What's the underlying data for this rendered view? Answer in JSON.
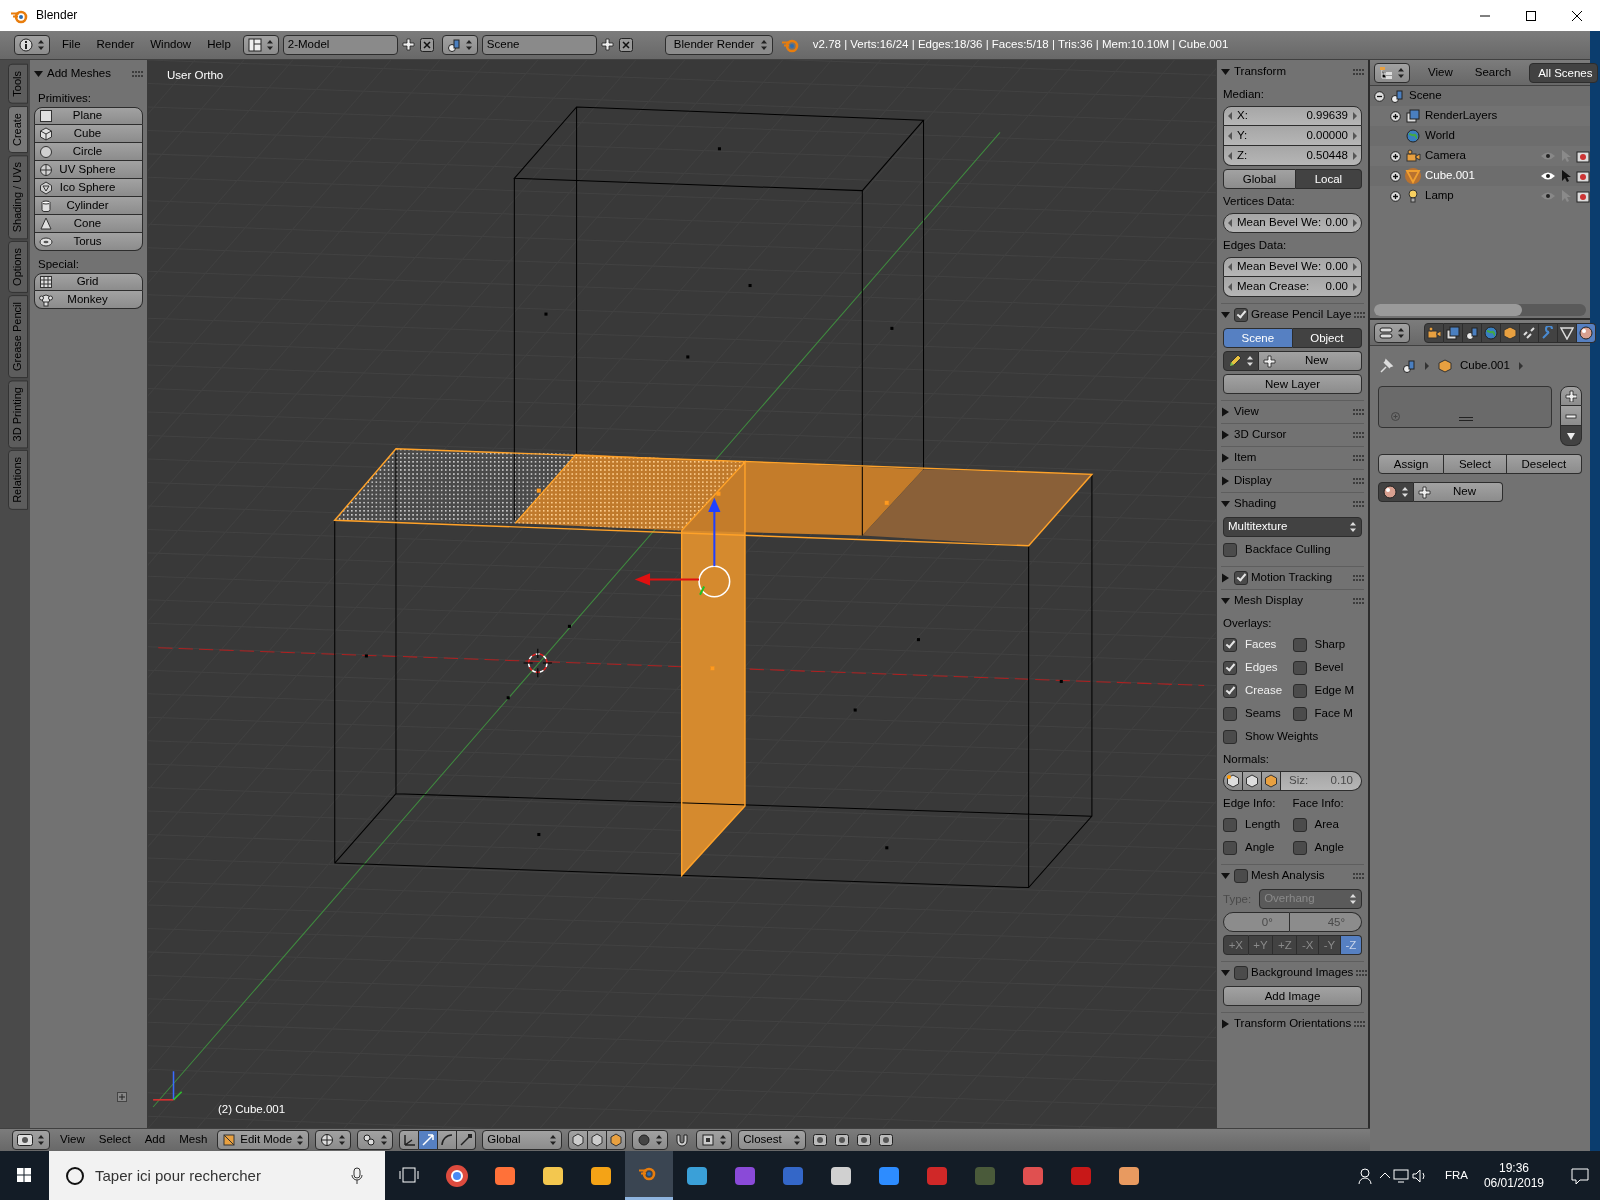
{
  "window": {
    "title": "Blender"
  },
  "info_header": {
    "menus": [
      "File",
      "Render",
      "Window",
      "Help"
    ],
    "screen_layout": "2-Model",
    "scene": "Scene",
    "render_engine": "Blender Render",
    "stats": "v2.78 | Verts:16/24 | Edges:18/36 | Faces:5/18 | Tris:36 | Mem:10.10M | Cube.001"
  },
  "tool_tabs": [
    {
      "label": "Tools",
      "selected": false
    },
    {
      "label": "Create",
      "selected": true
    },
    {
      "label": "Shading / UVs",
      "selected": false
    },
    {
      "label": "Options",
      "selected": false
    },
    {
      "label": "Grease Pencil",
      "selected": false
    },
    {
      "label": "3D Printing",
      "selected": false
    },
    {
      "label": "Relations",
      "selected": false
    }
  ],
  "tool_panel": {
    "title": "Add Meshes",
    "expanded": true,
    "groups": [
      {
        "label": "Primitives:",
        "buttons": [
          "Plane",
          "Cube",
          "Circle",
          "UV Sphere",
          "Ico Sphere",
          "Cylinder",
          "Cone",
          "Torus"
        ]
      },
      {
        "label": "Special:",
        "buttons": [
          "Grid",
          "Monkey"
        ]
      }
    ]
  },
  "viewport": {
    "view_name": "User Ortho",
    "object_info": "(2) Cube.001"
  },
  "properties_region": {
    "panels": [
      {
        "title": "Transform",
        "expanded": true,
        "rows": [
          {
            "kind": "label",
            "text": "Median:"
          },
          {
            "kind": "fields",
            "items": [
              {
                "label": "X:",
                "value": "0.99639"
              },
              {
                "label": "Y:",
                "value": "0.00000"
              },
              {
                "label": "Z:",
                "value": "0.50448"
              }
            ]
          },
          {
            "kind": "toggle",
            "items": [
              {
                "label": "Global",
                "selected": false
              },
              {
                "label": "Local",
                "selected": true
              }
            ]
          },
          {
            "kind": "label",
            "text": "Vertices Data:"
          },
          {
            "kind": "fields",
            "items": [
              {
                "label": "Mean Bevel We:",
                "value": "0.00"
              }
            ]
          },
          {
            "kind": "label",
            "text": "Edges Data:"
          },
          {
            "kind": "fields",
            "items": [
              {
                "label": "Mean Bevel We:",
                "value": "0.00"
              },
              {
                "label": "Mean Crease:",
                "value": "0.00"
              }
            ]
          }
        ]
      },
      {
        "title": "Grease Pencil Laye",
        "expanded": true,
        "enabled": true,
        "rows": [
          {
            "kind": "tabs",
            "items": [
              {
                "label": "Scene",
                "selected": true
              },
              {
                "label": "Object",
                "selected": false
              }
            ]
          },
          {
            "kind": "new",
            "text": "New"
          },
          {
            "kind": "button",
            "text": "New Layer"
          }
        ]
      },
      {
        "title": "View",
        "expanded": false
      },
      {
        "title": "3D Cursor",
        "expanded": false
      },
      {
        "title": "Item",
        "expanded": false
      },
      {
        "title": "Display",
        "expanded": false
      },
      {
        "title": "Shading",
        "expanded": true,
        "rows": [
          {
            "kind": "dropdown",
            "text": "Multitexture"
          },
          {
            "kind": "checkboxes",
            "items": [
              {
                "label": "Backface Culling",
                "checked": false
              }
            ]
          }
        ]
      },
      {
        "title": "Motion Tracking",
        "expanded": false,
        "enabled": true
      },
      {
        "title": "Mesh Display",
        "expanded": true,
        "rows": [
          {
            "kind": "label",
            "text": "Overlays:"
          },
          {
            "kind": "checkboxes",
            "items": [
              {
                "label": "Faces",
                "checked": true
              },
              {
                "label": "Sharp",
                "checked": false
              }
            ]
          },
          {
            "kind": "checkboxes",
            "items": [
              {
                "label": "Edges",
                "checked": true
              },
              {
                "label": "Bevel",
                "checked": false
              }
            ]
          },
          {
            "kind": "checkboxes",
            "items": [
              {
                "label": "Crease",
                "checked": true
              },
              {
                "label": "Edge M",
                "checked": false
              }
            ]
          },
          {
            "kind": "checkboxes",
            "items": [
              {
                "label": "Seams",
                "checked": false
              },
              {
                "label": "Face M",
                "checked": false
              }
            ]
          },
          {
            "kind": "checkboxes",
            "items": [
              {
                "label": "Show Weights",
                "checked": false
              }
            ]
          },
          {
            "kind": "label",
            "text": "Normals:"
          },
          {
            "kind": "normals",
            "label": "Siz:",
            "value": "0.10"
          },
          {
            "kind": "labels",
            "items": [
              "Edge Info:",
              "Face Info:"
            ]
          },
          {
            "kind": "checkboxes",
            "items": [
              {
                "label": "Length",
                "checked": false
              },
              {
                "label": "Area",
                "checked": false
              }
            ]
          },
          {
            "kind": "checkboxes",
            "items": [
              {
                "label": "Angle",
                "checked": false
              },
              {
                "label": "Angle",
                "checked": false
              }
            ]
          }
        ]
      },
      {
        "title": "Mesh Analysis",
        "expanded": true,
        "enabled": false,
        "rows": [
          {
            "kind": "labeled_dropdown",
            "label": "Type:",
            "value": "Overhang",
            "disabled": true
          },
          {
            "kind": "range",
            "items": [
              "0°",
              "45°"
            ],
            "disabled": true
          },
          {
            "kind": "tabs",
            "disabled": true,
            "items": [
              {
                "label": "+X",
                "selected": false
              },
              {
                "label": "+Y",
                "selected": false
              },
              {
                "label": "+Z",
                "selected": false
              },
              {
                "label": "-X",
                "selected": false
              },
              {
                "label": "-Y",
                "selected": false
              },
              {
                "label": "-Z",
                "selected": true
              }
            ]
          }
        ]
      },
      {
        "title": "Background Images",
        "expanded": true,
        "enabled": false,
        "rows": [
          {
            "kind": "button",
            "text": "Add Image"
          }
        ]
      },
      {
        "title": "Transform Orientations",
        "expanded": false
      }
    ]
  },
  "outliner": {
    "menus": [
      "View",
      "Search"
    ],
    "display_mode": "All Scenes",
    "tree": [
      {
        "label": "Scene",
        "kind": "scene",
        "expanded": true,
        "selected": false,
        "children": [
          {
            "label": "RenderLayers",
            "kind": "render_layers",
            "expanded": false,
            "selected": false
          },
          {
            "label": "World",
            "kind": "world",
            "selected": false
          },
          {
            "label": "Camera",
            "kind": "camera",
            "expanded": false,
            "selected": false
          },
          {
            "label": "Cube.001",
            "kind": "mesh",
            "expanded": false,
            "selected": true
          },
          {
            "label": "Lamp",
            "kind": "lamp",
            "expanded": false,
            "selected": false
          }
        ]
      }
    ]
  },
  "properties_editor": {
    "tabs": [
      {
        "kind": "render",
        "selected": false
      },
      {
        "kind": "render_layers",
        "selected": false
      },
      {
        "kind": "scene",
        "selected": false
      },
      {
        "kind": "world",
        "selected": false
      },
      {
        "kind": "object",
        "selected": false
      },
      {
        "kind": "constraints",
        "selected": false
      },
      {
        "kind": "modifiers",
        "selected": false
      },
      {
        "kind": "data",
        "selected": false
      },
      {
        "kind": "material",
        "selected": true
      }
    ],
    "breadcrumb": "Cube.001",
    "slot_actions": [
      "Assign",
      "Select",
      "Deselect"
    ],
    "new_button": "New"
  },
  "view3d_header": {
    "menus": [
      "View",
      "Select",
      "Add",
      "Mesh"
    ],
    "mode": "Edit Mode",
    "orientation": "Global",
    "snap_target": "Closest"
  },
  "taskbar": {
    "search_placeholder": "Taper ici pour rechercher",
    "apps": [
      {
        "selected": false
      },
      {
        "selected": false
      },
      {
        "selected": false
      },
      {
        "selected": false
      },
      {
        "selected": true
      },
      {
        "selected": false
      },
      {
        "selected": false
      },
      {
        "selected": false
      },
      {
        "selected": false
      },
      {
        "selected": false
      },
      {
        "selected": false
      },
      {
        "selected": false
      },
      {
        "selected": false
      },
      {
        "selected": false
      },
      {
        "selected": false
      }
    ],
    "language": "FRA",
    "time": "19:36",
    "date": "06/01/2019"
  }
}
